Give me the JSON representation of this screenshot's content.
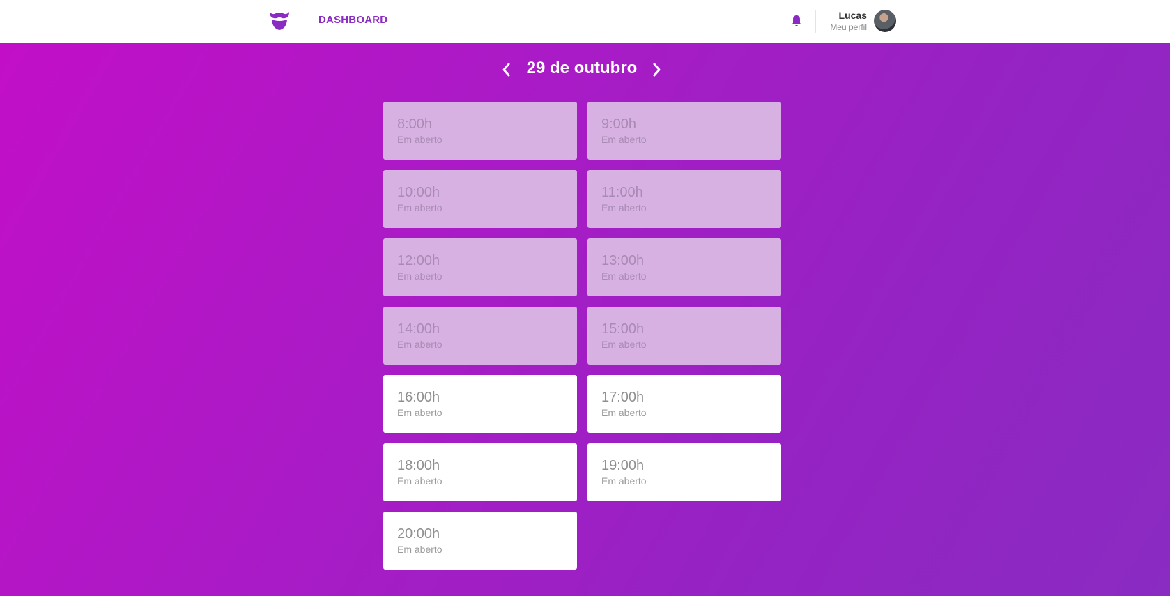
{
  "header": {
    "logo_icon": "mustache-logo-icon",
    "nav_label": "DASHBOARD",
    "notification_icon": "bell-icon",
    "profile": {
      "name": "Lucas",
      "subtitle": "Meu perfil",
      "avatar_icon": "user-avatar"
    }
  },
  "calendar": {
    "date_label": "29 de outubro",
    "prev_icon": "chevron-left-icon",
    "next_icon": "chevron-right-icon"
  },
  "slots": [
    {
      "time": "8:00h",
      "status": "Em aberto",
      "past": true
    },
    {
      "time": "9:00h",
      "status": "Em aberto",
      "past": true
    },
    {
      "time": "10:00h",
      "status": "Em aberto",
      "past": true
    },
    {
      "time": "11:00h",
      "status": "Em aberto",
      "past": true
    },
    {
      "time": "12:00h",
      "status": "Em aberto",
      "past": true
    },
    {
      "time": "13:00h",
      "status": "Em aberto",
      "past": true
    },
    {
      "time": "14:00h",
      "status": "Em aberto",
      "past": true
    },
    {
      "time": "15:00h",
      "status": "Em aberto",
      "past": true
    },
    {
      "time": "16:00h",
      "status": "Em aberto",
      "past": false
    },
    {
      "time": "17:00h",
      "status": "Em aberto",
      "past": false
    },
    {
      "time": "18:00h",
      "status": "Em aberto",
      "past": false
    },
    {
      "time": "19:00h",
      "status": "Em aberto",
      "past": false
    },
    {
      "time": "20:00h",
      "status": "Em aberto",
      "past": false
    }
  ],
  "colors": {
    "brand": "#8a2bc2",
    "gradient_start": "#c20fc7",
    "gradient_end": "#8a2bc2",
    "slot_past_bg": "#d8b1e3",
    "slot_available_bg": "#ffffff"
  }
}
